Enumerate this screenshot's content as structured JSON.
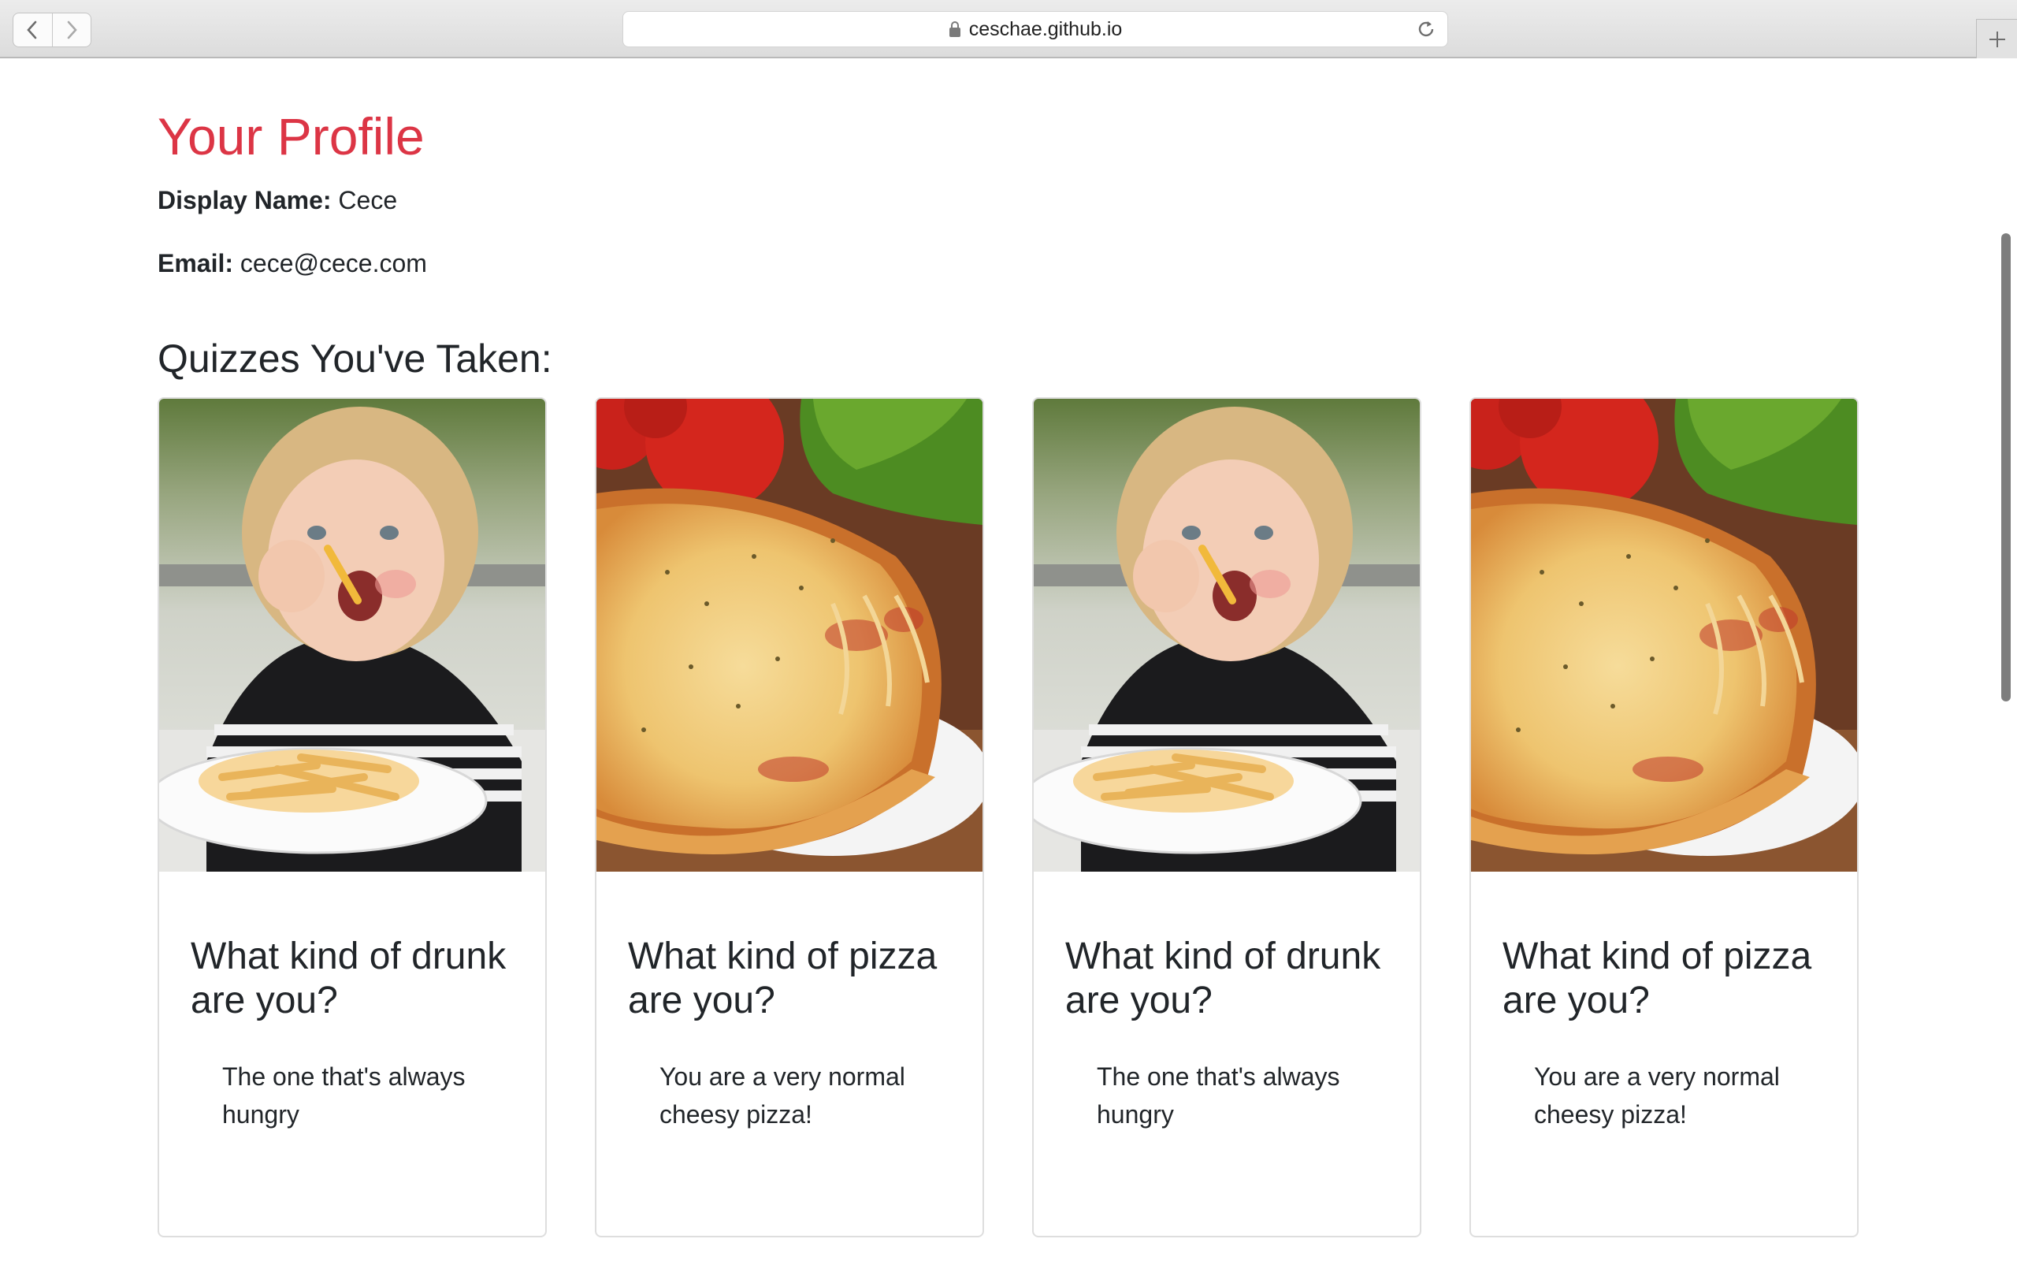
{
  "browser": {
    "url": "ceschae.github.io",
    "back_icon": "chevron-left-icon",
    "forward_icon": "chevron-right-icon",
    "lock_icon": "lock-icon",
    "reload_icon": "reload-icon",
    "new_tab_icon": "plus-icon"
  },
  "profile": {
    "title": "Your Profile",
    "display_name_label": "Display Name:",
    "display_name": "Cece",
    "email_label": "Email:",
    "email": "cece@cece.com"
  },
  "quizzes": {
    "heading": "Quizzes You've Taken:",
    "cards": [
      {
        "title": "What kind of drunk are you?",
        "result": "The one that's always hungry",
        "image": "girl-eating-fries"
      },
      {
        "title": "What kind of pizza are you?",
        "result": "You are a very normal cheesy pizza!",
        "image": "cheese-pizza"
      },
      {
        "title": "What kind of drunk are you?",
        "result": "The one that's always hungry",
        "image": "girl-eating-fries"
      },
      {
        "title": "What kind of pizza are you?",
        "result": "You are a very normal cheesy pizza!",
        "image": "cheese-pizza"
      }
    ]
  },
  "colors": {
    "accent": "#dc3545",
    "text": "#212529",
    "card_border": "#dedede"
  }
}
